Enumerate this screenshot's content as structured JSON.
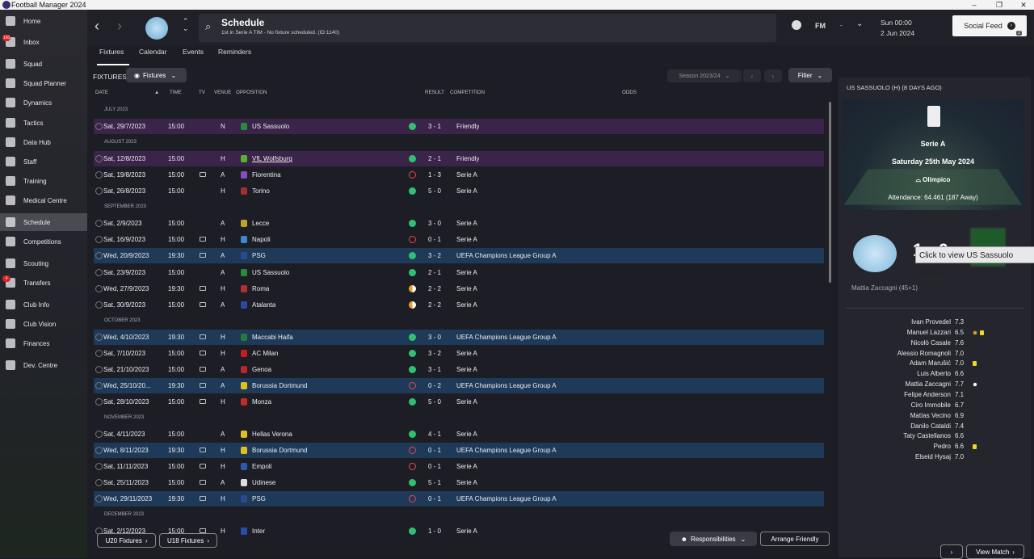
{
  "window": {
    "title": "Football Manager 2024"
  },
  "sidebar": {
    "items": [
      {
        "label": "Home",
        "icon": "home-icon"
      },
      {
        "label": "Inbox",
        "icon": "inbox-icon",
        "badge": "160"
      },
      {
        "label": "Squad",
        "icon": "shirt-icon"
      },
      {
        "label": "Squad Planner",
        "icon": "planner-icon"
      },
      {
        "label": "Dynamics",
        "icon": "dynamics-icon"
      },
      {
        "label": "Tactics",
        "icon": "tactics-icon"
      },
      {
        "label": "Data Hub",
        "icon": "datahub-icon"
      },
      {
        "label": "Staff",
        "icon": "staff-icon"
      },
      {
        "label": "Training",
        "icon": "training-icon"
      },
      {
        "label": "Medical Centre",
        "icon": "medical-icon"
      },
      {
        "label": "Schedule",
        "icon": "calendar-icon",
        "active": true
      },
      {
        "label": "Competitions",
        "icon": "trophy-icon"
      },
      {
        "label": "Scouting",
        "icon": "scouting-icon"
      },
      {
        "label": "Transfers",
        "icon": "transfers-icon",
        "badge": "4"
      },
      {
        "label": "Club Info",
        "icon": "shield-icon"
      },
      {
        "label": "Club Vision",
        "icon": "vision-icon"
      },
      {
        "label": "Finances",
        "icon": "finances-icon"
      },
      {
        "label": "Dev. Centre",
        "icon": "devcentre-icon"
      }
    ]
  },
  "header": {
    "title": "Schedule",
    "subtitle": "1st in Serie A TIM - No fixture scheduled. (ID:1140)",
    "fm_label": "FM",
    "dash": "-",
    "date_day": "Sun 00:00",
    "date": "2 Jun 2024",
    "social_feed": "Social Feed",
    "social_count": "2"
  },
  "tabs": [
    "Fixtures",
    "Calendar",
    "Events",
    "Reminders"
  ],
  "fixtures": {
    "label": "FIXTURES",
    "dropdown": "Fixtures",
    "season": "Season 2023/24",
    "filter": "Filter",
    "columns": {
      "date": "DATE",
      "time": "TIME",
      "tv": "TV",
      "venue": "VENUE",
      "opposition": "OPPOSITION",
      "result": "RESULT",
      "competition": "COMPETITION",
      "odds": "ODDS"
    },
    "rows": [
      {
        "month": "JULY 2023"
      },
      {
        "date": "Sat, 29/7/2023",
        "time": "15:00",
        "tv": false,
        "venue": "N",
        "opp": "US Sassuolo",
        "res": "w",
        "score": "3 - 1",
        "comp": "Friendly",
        "hl": "purple",
        "crest": "#2a8a3a"
      },
      {
        "month": "AUGUST 2023"
      },
      {
        "date": "Sat, 12/8/2023",
        "time": "15:00",
        "tv": false,
        "venue": "H",
        "opp": "VfL Wolfsburg",
        "res": "w",
        "score": "2 - 1",
        "comp": "Friendly",
        "hl": "purple",
        "crest": "#5ab030",
        "underline": true
      },
      {
        "date": "Sat, 19/8/2023",
        "time": "15:00",
        "tv": true,
        "venue": "A",
        "opp": "Fiorentina",
        "res": "l",
        "score": "1 - 3",
        "comp": "Serie A",
        "crest": "#8a4ac0"
      },
      {
        "date": "Sat, 26/8/2023",
        "time": "15:00",
        "tv": false,
        "venue": "H",
        "opp": "Torino",
        "res": "w",
        "score": "5 - 0",
        "comp": "Serie A",
        "crest": "#a03030"
      },
      {
        "month": "SEPTEMBER 2023"
      },
      {
        "date": "Sat, 2/9/2023",
        "time": "15:00",
        "tv": false,
        "venue": "A",
        "opp": "Lecce",
        "res": "w",
        "score": "3 - 0",
        "comp": "Serie A",
        "crest": "#c0a030"
      },
      {
        "date": "Sat, 16/9/2023",
        "time": "15:00",
        "tv": true,
        "venue": "H",
        "opp": "Napoli",
        "res": "l",
        "score": "0 - 1",
        "comp": "Serie A",
        "crest": "#3a8ad0"
      },
      {
        "date": "Wed, 20/9/2023",
        "time": "19:30",
        "tv": true,
        "venue": "A",
        "opp": "PSG",
        "res": "w",
        "score": "3 - 2",
        "comp": "UEFA Champions League Group A",
        "hl": "blue",
        "crest": "#2a4a90"
      },
      {
        "date": "Sat, 23/9/2023",
        "time": "15:00",
        "tv": false,
        "venue": "A",
        "opp": "US Sassuolo",
        "res": "w",
        "score": "2 - 1",
        "comp": "Serie A",
        "crest": "#2a8a3a"
      },
      {
        "date": "Wed, 27/9/2023",
        "time": "19:30",
        "tv": true,
        "venue": "H",
        "opp": "Roma",
        "res": "d",
        "score": "2 - 2",
        "comp": "Serie A",
        "crest": "#b03030"
      },
      {
        "date": "Sat, 30/9/2023",
        "time": "15:00",
        "tv": true,
        "venue": "A",
        "opp": "Atalanta",
        "res": "d",
        "score": "2 - 2",
        "comp": "Serie A",
        "crest": "#2a4aa0"
      },
      {
        "month": "OCTOBER 2023"
      },
      {
        "date": "Wed, 4/10/2023",
        "time": "19:30",
        "tv": true,
        "venue": "H",
        "opp": "Maccabi Haifa",
        "res": "w",
        "score": "3 - 0",
        "comp": "UEFA Champions League Group A",
        "hl": "blue",
        "crest": "#2a7a3a"
      },
      {
        "date": "Sat, 7/10/2023",
        "time": "15:00",
        "tv": true,
        "venue": "H",
        "opp": "AC Milan",
        "res": "w",
        "score": "3 - 2",
        "comp": "Serie A",
        "crest": "#c02020"
      },
      {
        "date": "Sat, 21/10/2023",
        "time": "15:00",
        "tv": true,
        "venue": "A",
        "opp": "Genoa",
        "res": "w",
        "score": "3 - 1",
        "comp": "Serie A",
        "crest": "#b02a2a"
      },
      {
        "date": "Wed, 25/10/20...",
        "time": "19:30",
        "tv": true,
        "venue": "A",
        "opp": "Borussia Dortmund",
        "res": "l",
        "score": "0 - 2",
        "comp": "UEFA Champions League Group A",
        "hl": "blue",
        "crest": "#e0c020"
      },
      {
        "date": "Sat, 28/10/2023",
        "time": "15:00",
        "tv": true,
        "venue": "H",
        "opp": "Monza",
        "res": "w",
        "score": "5 - 0",
        "comp": "Serie A",
        "crest": "#c02a2a"
      },
      {
        "month": "NOVEMBER 2023"
      },
      {
        "date": "Sat, 4/11/2023",
        "time": "15:00",
        "tv": false,
        "venue": "A",
        "opp": "Hellas Verona",
        "res": "w",
        "score": "4 - 1",
        "comp": "Serie A",
        "crest": "#e0c020"
      },
      {
        "date": "Wed, 8/11/2023",
        "time": "19:30",
        "tv": true,
        "venue": "H",
        "opp": "Borussia Dortmund",
        "res": "l",
        "score": "0 - 1",
        "comp": "UEFA Champions League Group A",
        "hl": "blue",
        "crest": "#e0c020"
      },
      {
        "date": "Sat, 11/11/2023",
        "time": "15:00",
        "tv": true,
        "venue": "H",
        "opp": "Empoli",
        "res": "l",
        "score": "0 - 1",
        "comp": "Serie A",
        "crest": "#2a5ab0"
      },
      {
        "date": "Sat, 25/11/2023",
        "time": "15:00",
        "tv": true,
        "venue": "A",
        "opp": "Udinese",
        "res": "w",
        "score": "5 - 1",
        "comp": "Serie A",
        "crest": "#dddddd"
      },
      {
        "date": "Wed, 29/11/2023",
        "time": "19:30",
        "tv": true,
        "venue": "H",
        "opp": "PSG",
        "res": "l",
        "score": "0 - 1",
        "comp": "UEFA Champions League Group A",
        "hl": "blue",
        "crest": "#2a4a90"
      },
      {
        "month": "DECEMBER 2023"
      },
      {
        "date": "Sat, 2/12/2023",
        "time": "15:00",
        "tv": true,
        "venue": "H",
        "opp": "Inter",
        "res": "w",
        "score": "1 - 0",
        "comp": "Serie A",
        "crest": "#2a4ab0"
      }
    ],
    "footer": {
      "u20": "U20 Fixtures",
      "u18": "U18 Fixtures",
      "responsibilities": "Responsibilities",
      "arrange": "Arrange Friendly"
    }
  },
  "match_panel": {
    "title": "US SASSUOLO (H) (8 DAYS AGO)",
    "competition": "Serie A",
    "match_date": "Saturday 25th May 2024",
    "stadium": "Olimpico",
    "attendance": "Attendance: 64.461 (187 Away)",
    "score": "1 - 0",
    "tooltip": "Click to view US Sassuolo Calcio",
    "scorer": "Mattia Zaccagni (45+1)",
    "players": [
      {
        "name": "Ivan Provedel",
        "rating": "7.3"
      },
      {
        "name": "Manuel Lazzari",
        "rating": "6.5",
        "events": [
          "sub",
          "yellow"
        ]
      },
      {
        "name": "Nicolò Casale",
        "rating": "7.6"
      },
      {
        "name": "Alessio Romagnoli",
        "rating": "7.0"
      },
      {
        "name": "Adam Marušić",
        "rating": "7.0",
        "events": [
          "yellow"
        ]
      },
      {
        "name": "Luis Alberto",
        "rating": "6.6"
      },
      {
        "name": "Mattia Zaccagni",
        "rating": "7.7",
        "events": [
          "goal"
        ]
      },
      {
        "name": "Felipe Anderson",
        "rating": "7.1"
      },
      {
        "name": "Ciro Immobile",
        "rating": "6.7"
      },
      {
        "name": "Matías Vecino",
        "rating": "6.9"
      },
      {
        "name": "Danilo Cataldi",
        "rating": "7.4"
      },
      {
        "name": "Taty Castellanos",
        "rating": "6.6"
      },
      {
        "name": "Pedro",
        "rating": "6.6",
        "events": [
          "yellow"
        ]
      },
      {
        "name": "Elseid Hysaj",
        "rating": "7.0"
      }
    ],
    "view_match": "View Match"
  }
}
